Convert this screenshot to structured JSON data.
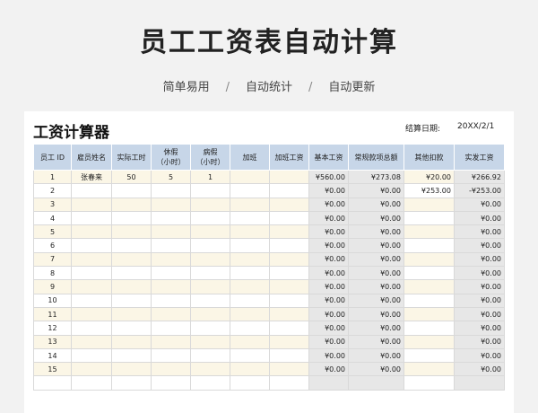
{
  "banner": {
    "title": "员工工资表自动计算",
    "taglines": [
      "简单易用",
      "自动统计",
      "自动更新"
    ]
  },
  "sheet": {
    "title": "工资计算器",
    "date_label": "结算日期:",
    "date_value": "20XX/2/1",
    "headers": [
      "员工 ID",
      "雇员姓名",
      "实际工时",
      "休假\n（小时）",
      "病假\n（小时）",
      "加班",
      "加班工资",
      "基本工资",
      "常规款项总额",
      "其他扣款",
      "实发工资"
    ],
    "rows": [
      [
        "1",
        "张春来",
        "50",
        "5",
        "1",
        "",
        "",
        "¥560.00",
        "¥273.08",
        "¥20.00",
        "¥266.92"
      ],
      [
        "2",
        "",
        "",
        "",
        "",
        "",
        "",
        "¥0.00",
        "¥0.00",
        "¥253.00",
        "-¥253.00"
      ],
      [
        "3",
        "",
        "",
        "",
        "",
        "",
        "",
        "¥0.00",
        "¥0.00",
        "",
        "¥0.00"
      ],
      [
        "4",
        "",
        "",
        "",
        "",
        "",
        "",
        "¥0.00",
        "¥0.00",
        "",
        "¥0.00"
      ],
      [
        "5",
        "",
        "",
        "",
        "",
        "",
        "",
        "¥0.00",
        "¥0.00",
        "",
        "¥0.00"
      ],
      [
        "6",
        "",
        "",
        "",
        "",
        "",
        "",
        "¥0.00",
        "¥0.00",
        "",
        "¥0.00"
      ],
      [
        "7",
        "",
        "",
        "",
        "",
        "",
        "",
        "¥0.00",
        "¥0.00",
        "",
        "¥0.00"
      ],
      [
        "8",
        "",
        "",
        "",
        "",
        "",
        "",
        "¥0.00",
        "¥0.00",
        "",
        "¥0.00"
      ],
      [
        "9",
        "",
        "",
        "",
        "",
        "",
        "",
        "¥0.00",
        "¥0.00",
        "",
        "¥0.00"
      ],
      [
        "10",
        "",
        "",
        "",
        "",
        "",
        "",
        "¥0.00",
        "¥0.00",
        "",
        "¥0.00"
      ],
      [
        "11",
        "",
        "",
        "",
        "",
        "",
        "",
        "¥0.00",
        "¥0.00",
        "",
        "¥0.00"
      ],
      [
        "12",
        "",
        "",
        "",
        "",
        "",
        "",
        "¥0.00",
        "¥0.00",
        "",
        "¥0.00"
      ],
      [
        "13",
        "",
        "",
        "",
        "",
        "",
        "",
        "¥0.00",
        "¥0.00",
        "",
        "¥0.00"
      ],
      [
        "14",
        "",
        "",
        "",
        "",
        "",
        "",
        "¥0.00",
        "¥0.00",
        "",
        "¥0.00"
      ],
      [
        "15",
        "",
        "",
        "",
        "",
        "",
        "",
        "¥0.00",
        "¥0.00",
        "",
        "¥0.00"
      ],
      [
        "",
        "",
        "",
        "",
        "",
        "",
        "",
        "",
        "",
        "",
        ""
      ]
    ]
  },
  "colors": {
    "header_bg": "#c7d6e8",
    "odd_row_bg": "#fbf6e6",
    "calc_col_bg": "#e7e7e7"
  }
}
